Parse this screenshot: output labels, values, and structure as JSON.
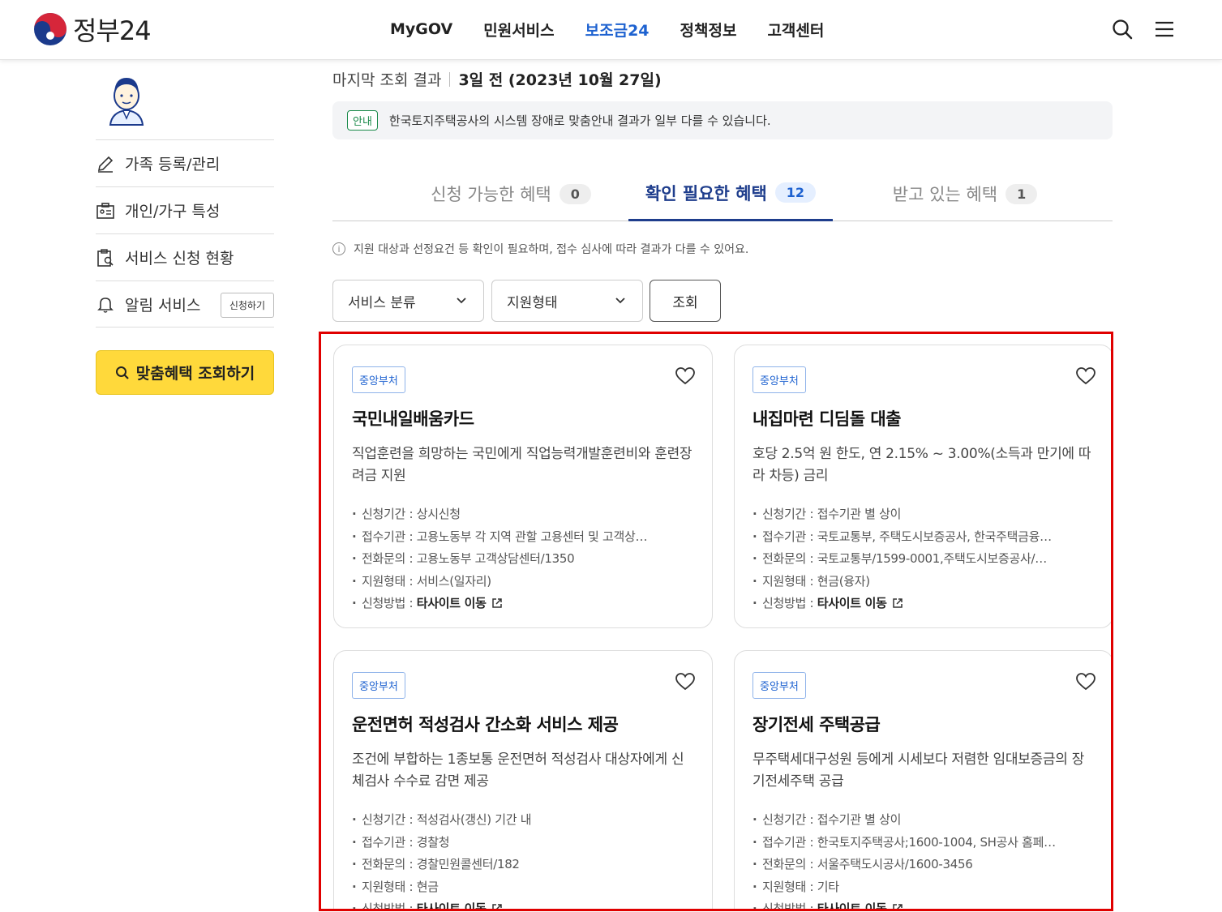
{
  "header": {
    "logo_text": "정부24",
    "nav": [
      "MyGOV",
      "민원서비스",
      "보조금24",
      "정책정보",
      "고객센터"
    ],
    "active_nav_index": 2,
    "icons": [
      "search-icon",
      "menu-icon"
    ]
  },
  "sidebar": {
    "items": [
      {
        "label": "가족 등록/관리",
        "icon": "pencil-icon"
      },
      {
        "label": "개인/가구 특성",
        "icon": "id-card-icon"
      },
      {
        "label": "서비스 신청 현황",
        "icon": "clipboard-search-icon"
      },
      {
        "label": "알림 서비스",
        "icon": "bell-icon",
        "pill": "신청하기"
      }
    ],
    "cta": "맞춤혜택 조회하기"
  },
  "main": {
    "last_result_label": "마지막 조회 결과",
    "last_result_value": "3일 전 (2023년 10월 27일)",
    "notice_badge": "안내",
    "notice_text": "한국토지주택공사의 시스템 장애로 맞춤안내 결과가 일부 다를 수 있습니다.",
    "tabs": [
      {
        "label": "신청 가능한 혜택",
        "count": "0"
      },
      {
        "label": "확인 필요한 혜택",
        "count": "12"
      },
      {
        "label": "받고 있는 혜택",
        "count": "1"
      }
    ],
    "active_tab_index": 1,
    "info_text": "지원 대상과 선정요건 등 확인이 필요하며, 접수 심사에 따라 결과가 다를 수 있어요.",
    "filters": {
      "category": "서비스 분류",
      "support_type": "지원형태",
      "search_button": "조회"
    },
    "cards": [
      {
        "badge": "중앙부처",
        "title": "국민내일배움카드",
        "desc": "직업훈련을 희망하는 국민에게 직업능력개발훈련비와 훈련장려금 지원",
        "period": "신청기간 : 상시신청",
        "agency": "접수기관 : 고용노동부 각 지역 관할 고용센터 및 고객상…",
        "phone": "전화문의 : 고용노동부 고객상담센터/1350",
        "type": "지원형태 : 서비스(일자리)",
        "method_label": "신청방법 : ",
        "method_value": "타사이트 이동"
      },
      {
        "badge": "중앙부처",
        "title": "내집마련 디딤돌 대출",
        "desc": "호당 2.5억 원 한도, 연 2.15% ~ 3.00%(소득과 만기에 따라 차등) 금리",
        "period": "신청기간 : 접수기관 별 상이",
        "agency": "접수기관 : 국토교통부, 주택도시보증공사, 한국주택금융…",
        "phone": "전화문의 : 국토교통부/1599-0001,주택도시보증공사/…",
        "type": "지원형태 : 현금(융자)",
        "method_label": "신청방법 : ",
        "method_value": "타사이트 이동"
      },
      {
        "badge": "중앙부처",
        "title": "운전면허 적성검사 간소화 서비스 제공",
        "desc": "조건에 부합하는 1종보통 운전면허 적성검사 대상자에게 신체검사 수수료 감면 제공",
        "period": "신청기간 : 적성검사(갱신) 기간 내",
        "agency": "접수기관 : 경찰청",
        "phone": "전화문의 : 경찰민원콜센터/182",
        "type": "지원형태 : 현금",
        "method_label": "신청방법 : ",
        "method_value": "타사이트 이동"
      },
      {
        "badge": "중앙부처",
        "title": "장기전세 주택공급",
        "desc": "무주택세대구성원 등에게 시세보다 저렴한 임대보증금의 장기전세주택 공급",
        "period": "신청기간 : 접수기관 별 상이",
        "agency": "접수기관 : 한국토지주택공사;1600-1004, SH공사 홈페…",
        "phone": "전화문의 : 서울주택도시공사/1600-3456",
        "type": "지원형태 : 기타",
        "method_label": "신청방법 : ",
        "method_value": "타사이트 이동"
      }
    ]
  },
  "colors": {
    "accent_blue": "#1e62d0",
    "cta_yellow": "#ffd93b",
    "highlight_red": "#e00000",
    "notice_green": "#1a8a4a"
  }
}
